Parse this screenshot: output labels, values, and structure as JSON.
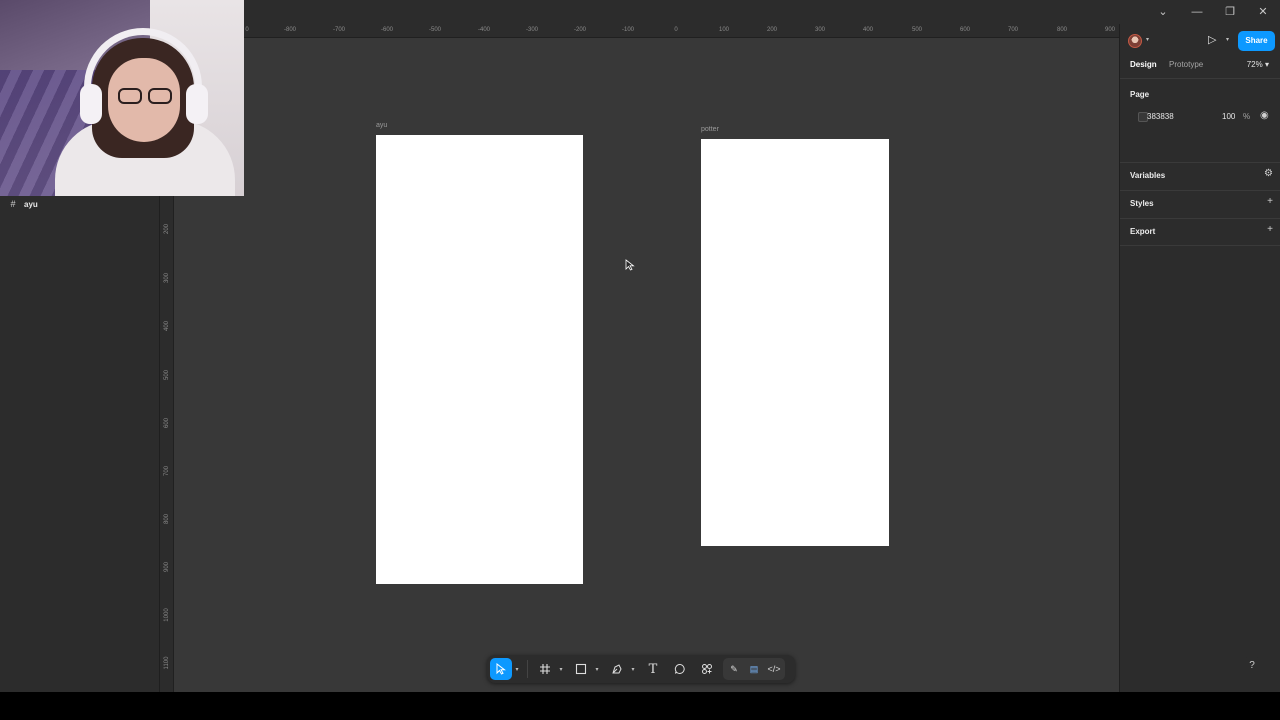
{
  "window": {
    "controls": [
      "⌄",
      "—",
      "❐",
      "✕"
    ]
  },
  "layers": [
    {
      "icon": "frame-icon",
      "label": "ayu"
    }
  ],
  "ruler": {
    "top_ticks": [
      "0",
      "-800",
      "-700",
      "-600",
      "-500",
      "-400",
      "-300",
      "-200",
      "-100",
      "0",
      "100",
      "200",
      "300",
      "400",
      "500",
      "600",
      "700",
      "800",
      "900"
    ],
    "left_ticks": [
      "200",
      "300",
      "400",
      "500",
      "600",
      "700",
      "800",
      "900",
      "1000",
      "1100"
    ]
  },
  "canvas": {
    "frames": [
      {
        "label": "ayu"
      },
      {
        "label": "potter"
      }
    ]
  },
  "toolbar": {
    "tools": [
      "move-tool",
      "frame-tool",
      "shape-tool",
      "pen-tool",
      "text-tool",
      "comment-tool",
      "actions-tool"
    ],
    "text_tool_glyph": "T"
  },
  "right_panel": {
    "share_label": "Share",
    "tabs": [
      "Design",
      "Prototype"
    ],
    "zoom": "72%",
    "page": {
      "title": "Page",
      "fill_hex": "383838",
      "opacity": "100",
      "opacity_unit": "%"
    },
    "sections": [
      "Variables",
      "Styles",
      "Export"
    ]
  },
  "help_label": "?",
  "colors": {
    "accent": "#0d99ff",
    "canvas": "#383838",
    "panel": "#2c2c2c"
  }
}
